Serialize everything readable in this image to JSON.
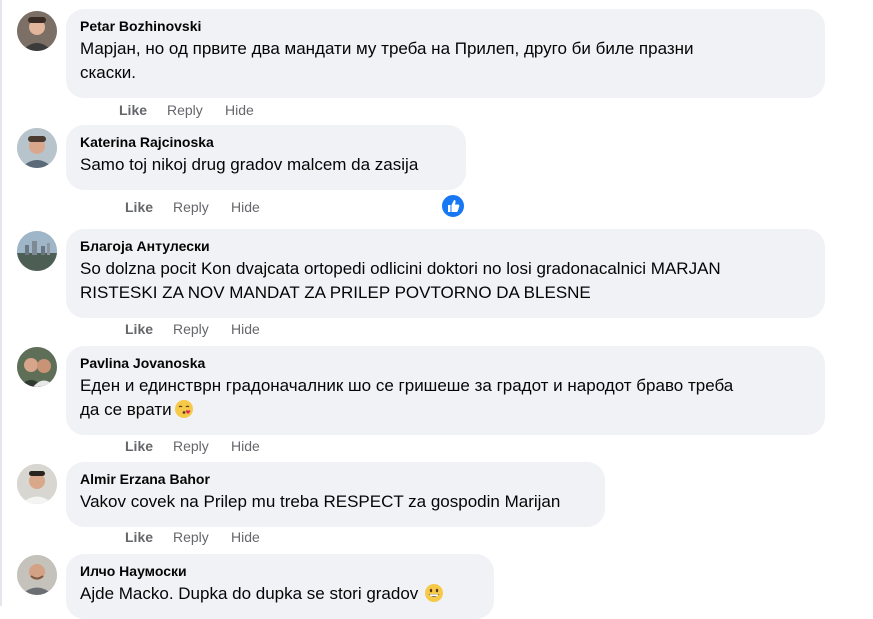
{
  "actions": {
    "like": "Like",
    "reply": "Reply",
    "hide": "Hide"
  },
  "comments": [
    {
      "author": "Petar Bozhinovski",
      "lines": [
        "Марјан, но од првите два мандати му треба на Прилеп, друго би биле празни",
        "скаски."
      ]
    },
    {
      "author": "Katerina Rajcinoska",
      "lines": [
        "Samo toj nikoj drug gradov malcem da zasija"
      ],
      "reaction": "like-reaction-icon"
    },
    {
      "author": "Благоја Антулески",
      "lines": [
        "So dolzna pocit Kon dvajcata ortopedi odlicini doktori no losi gradonacalnici MARJAN",
        "RISTESKI ZA NOV MANDAT ZA PRILEP POVTORNO DA BLESNE"
      ]
    },
    {
      "author": "Pavlina Jovanoska",
      "lines": [
        "Еден и единстврн градоначалник шо се гришеше за градот и народот браво треба",
        "да се врати"
      ],
      "emoji": "kissing-face-emoji-icon"
    },
    {
      "author": "Almir Erzana Bahor",
      "lines": [
        "Vakov covek na Prilep mu treba RESPECT za gospodin Marijan"
      ]
    },
    {
      "author": "Илчо Наумоски",
      "lines": [
        "Ajde Macko. Dupka do dupka se stori gradov"
      ],
      "emoji": "grinning-face-emoji-icon"
    }
  ],
  "colors": {
    "bubble": "#f0f2f5",
    "action": "#65676b",
    "text": "#050505",
    "accent": "#1877f2"
  }
}
